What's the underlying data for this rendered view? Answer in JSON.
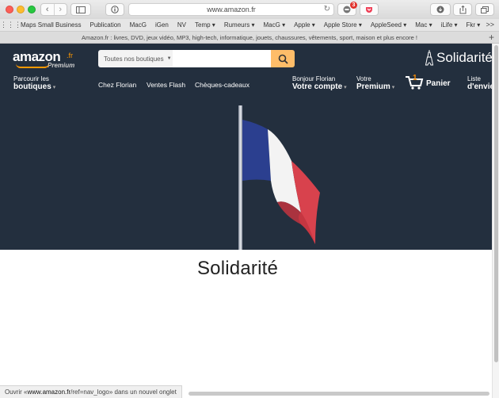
{
  "browser": {
    "url": "www.amazon.fr",
    "extension_badge": "3",
    "tab_title": "Amazon.fr : livres, DVD, jeux vidéo, MP3, high-tech, informatique, jouets, chaussures, vêtements, sport, maison et plus encore !",
    "favorites": [
      "Maps Small Business",
      "Publication",
      "MacG",
      "iGen",
      "NV",
      "Temp ▾",
      "Rumeurs ▾",
      "MacG ▾",
      "Apple ▾",
      "Apple Store ▾",
      "AppleSeed ▾",
      "Mac ▾",
      "iLife ▾",
      "Fkr ▾"
    ],
    "more": ">>"
  },
  "amazon": {
    "logo": "amazon",
    "logo_suffix": ".fr",
    "logo_premium": "Premium",
    "search_category": "Toutes nos boutiques",
    "search_value": "",
    "solidarity_banner": "Solidarité",
    "nav": {
      "browse_line1": "Parcourir les",
      "browse_line2": "boutiques",
      "links": [
        "Chez Florian",
        "Ventes Flash",
        "Chèques-cadeaux"
      ],
      "account_line1": "Bonjour Florian",
      "account_line2": "Votre compte",
      "premium_line1": "Votre",
      "premium_line2": "Premium",
      "cart_count": "1",
      "cart_label": "Panier",
      "list_line1": "Liste",
      "list_line2": "d'envie"
    }
  },
  "page": {
    "headline": "Solidarité"
  },
  "status_bar": {
    "prefix": "Ouvrir « ",
    "link": "www.amazon.fr",
    "path": "/ref=nav_logo",
    "suffix": " » dans un nouvel onglet"
  },
  "colors": {
    "amazon_nav": "#232f3e",
    "accent_orange": "#febd69",
    "flag_blue": "#2b3f8f",
    "flag_white": "#f3f3f3",
    "flag_red": "#d8424d"
  }
}
